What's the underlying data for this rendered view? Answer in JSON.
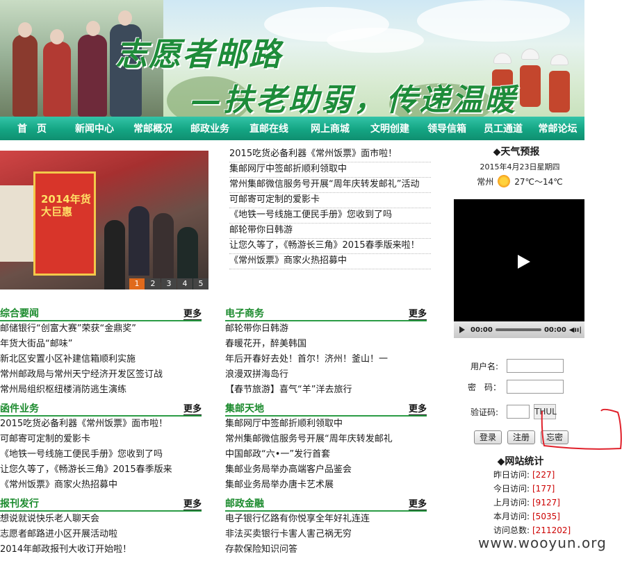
{
  "banner": {
    "title_line1": "志愿者邮路",
    "title_line2": "—扶老助弱，传递温暖"
  },
  "nav": [
    "首　页",
    "新闻中心",
    "常邮概况",
    "邮政业务",
    "直邮在线",
    "网上商城",
    "文明创建",
    "领导信箱",
    "员工通道",
    "常邮论坛"
  ],
  "slideshow": {
    "poster_text": "2014年货大巨惠",
    "pages": [
      "1",
      "2",
      "3",
      "4",
      "5"
    ],
    "active": "1"
  },
  "top_news": [
    "2015吃货必备利器《常州饭票》面市啦！",
    "集邮网厅中签邮折顺利领取中",
    "常州集邮微信服务号开展“周年庆转发邮礼”活动",
    "可邮寄可定制的爱影卡",
    "《地铁一号线施工便民手册》您收到了吗",
    "邮轮带你日韩游",
    "让您久等了，《畅游长三角》2015春季版来啦！",
    "《常州饭票》商家火热招募中"
  ],
  "sections": [
    {
      "title": "综合要闻",
      "more": "更多",
      "items": [
        "邮储银行“创富大赛”荣获“金鼎奖”",
        "年货大街品“邮味”",
        "新北区安置小区补建信箱顺利实施",
        "常州邮政局与常州天宁经济开发区签订战",
        "常州局组织枢纽楼消防逃生演练"
      ]
    },
    {
      "title": "电子商务",
      "more": "更多",
      "items": [
        "邮轮带你日韩游",
        "春暖花开，醉美韩国",
        "年后开春好去处！首尔！济州！釜山！一",
        "浪漫双拼海岛行",
        "【春节旅游】喜气“羊”洋去旅行"
      ]
    },
    {
      "title": "函件业务",
      "more": "更多",
      "items": [
        "2015吃货必备利器《常州饭票》面市啦！",
        "可邮寄可定制的爱影卡",
        "《地铁一号线施工便民手册》您收到了吗",
        "让您久等了，《畅游长三角》2015春季版来",
        "《常州饭票》商家火热招募中"
      ]
    },
    {
      "title": "集邮天地",
      "more": "更多",
      "items": [
        "集邮网厅中签邮折顺利领取中",
        "常州集邮微信服务号开展“周年庆转发邮礼",
        "中国邮政“六•一”发行首套",
        "集邮业务局举办高端客户品鉴会",
        "集邮业务局举办唐卡艺术展"
      ]
    },
    {
      "title": "报刊发行",
      "more": "更多",
      "items": [
        "想说就说快乐老人聊天会",
        "志愿者邮路进小区开展活动啦",
        "2014年邮政报刊大收订开始啦！"
      ]
    },
    {
      "title": "邮政金融",
      "more": "更多",
      "items": [
        "电子银行亿路有你悦享全年好礼连连",
        "非法买卖银行卡害人害己祸无穷",
        "存款保险知识问答"
      ]
    }
  ],
  "weather": {
    "title": "◆天气预报",
    "date": "2015年4月23日星期四",
    "city": "常州",
    "temp": "27℃～14℃"
  },
  "video": {
    "time_current": "00:00",
    "time_total": "00:00"
  },
  "login": {
    "username_label": "用户名:",
    "password_label": "密　码：",
    "captcha_label": "验证码:",
    "captcha_value": "THUL",
    "login_btn": "登录",
    "register_btn": "注册",
    "forgot_btn": "忘密"
  },
  "stats": {
    "title": "◆网站统计",
    "rows": [
      {
        "label": "昨日访问:",
        "value": "[227]"
      },
      {
        "label": "今日访问:",
        "value": "[177]"
      },
      {
        "label": "上月访问:",
        "value": "[9127]"
      },
      {
        "label": "本月访问:",
        "value": "[5035]"
      },
      {
        "label": "访问总数:",
        "value": "[211202]"
      }
    ]
  },
  "watermark": "www.wooyun.org",
  "colors": {
    "nav_green": "#14a583",
    "section_green": "#1a8a2c",
    "stat_red": "#cc0000",
    "annotation_red": "#e0202a"
  }
}
